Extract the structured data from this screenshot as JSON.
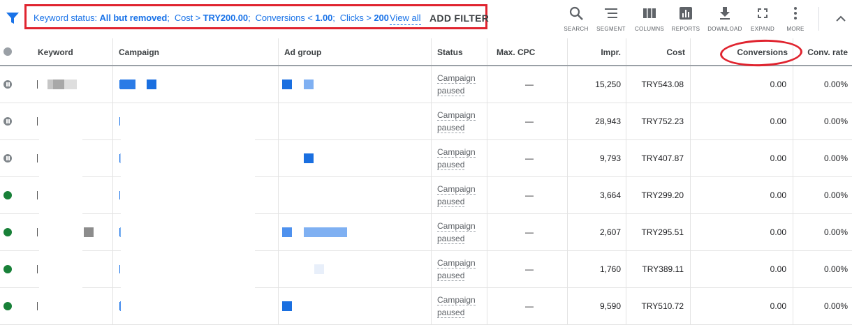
{
  "filter": {
    "status_label": "Keyword status:",
    "status_value": "All but removed",
    "cost_label": "Cost >",
    "cost_value": "TRY200.00",
    "conv_label": "Conversions <",
    "conv_value": "1.00",
    "clicks_label": "Clicks >",
    "clicks_value": "200",
    "view_all": "View all",
    "add_filter": "ADD FILTER"
  },
  "tools": [
    {
      "label": "SEARCH",
      "icon": "search-icon"
    },
    {
      "label": "SEGMENT",
      "icon": "segment-icon"
    },
    {
      "label": "COLUMNS",
      "icon": "columns-icon"
    },
    {
      "label": "REPORTS",
      "icon": "reports-icon"
    },
    {
      "label": "DOWNLOAD",
      "icon": "download-icon"
    },
    {
      "label": "EXPAND",
      "icon": "expand-icon"
    },
    {
      "label": "MORE",
      "icon": "more-icon"
    }
  ],
  "columns": {
    "keyword": "Keyword",
    "campaign": "Campaign",
    "ad_group": "Ad group",
    "status": "Status",
    "max_cpc": "Max. CPC",
    "impr": "Impr.",
    "cost": "Cost",
    "conversions": "Conversions",
    "conv_rate": "Conv. rate"
  },
  "colors": {
    "accent": "#1a73e8",
    "highlight": "#e0242f",
    "enabled": "#188038",
    "paused": "#80868b"
  },
  "rows": [
    {
      "state": "paused",
      "status_line1": "Campaign",
      "status_line2": "paused",
      "max_cpc": "—",
      "impr": "15,250",
      "cost": "TRY543.08",
      "conversions": "0.00",
      "conv_rate": "0.00%"
    },
    {
      "state": "paused",
      "status_line1": "Campaign",
      "status_line2": "paused",
      "max_cpc": "—",
      "impr": "28,943",
      "cost": "TRY752.23",
      "conversions": "0.00",
      "conv_rate": "0.00%"
    },
    {
      "state": "paused",
      "status_line1": "Campaign",
      "status_line2": "paused",
      "max_cpc": "—",
      "impr": "9,793",
      "cost": "TRY407.87",
      "conversions": "0.00",
      "conv_rate": "0.00%"
    },
    {
      "state": "enabled",
      "status_line1": "Campaign",
      "status_line2": "paused",
      "max_cpc": "—",
      "impr": "3,664",
      "cost": "TRY299.20",
      "conversions": "0.00",
      "conv_rate": "0.00%"
    },
    {
      "state": "enabled",
      "status_line1": "Campaign",
      "status_line2": "paused",
      "max_cpc": "—",
      "impr": "2,607",
      "cost": "TRY295.51",
      "conversions": "0.00",
      "conv_rate": "0.00%"
    },
    {
      "state": "enabled",
      "status_line1": "Campaign",
      "status_line2": "paused",
      "max_cpc": "—",
      "impr": "1,760",
      "cost": "TRY389.11",
      "conversions": "0.00",
      "conv_rate": "0.00%"
    },
    {
      "state": "enabled",
      "status_line1": "Campaign",
      "status_line2": "paused",
      "max_cpc": "—",
      "impr": "9,590",
      "cost": "TRY510.72",
      "conversions": "0.00",
      "conv_rate": "0.00%"
    }
  ]
}
